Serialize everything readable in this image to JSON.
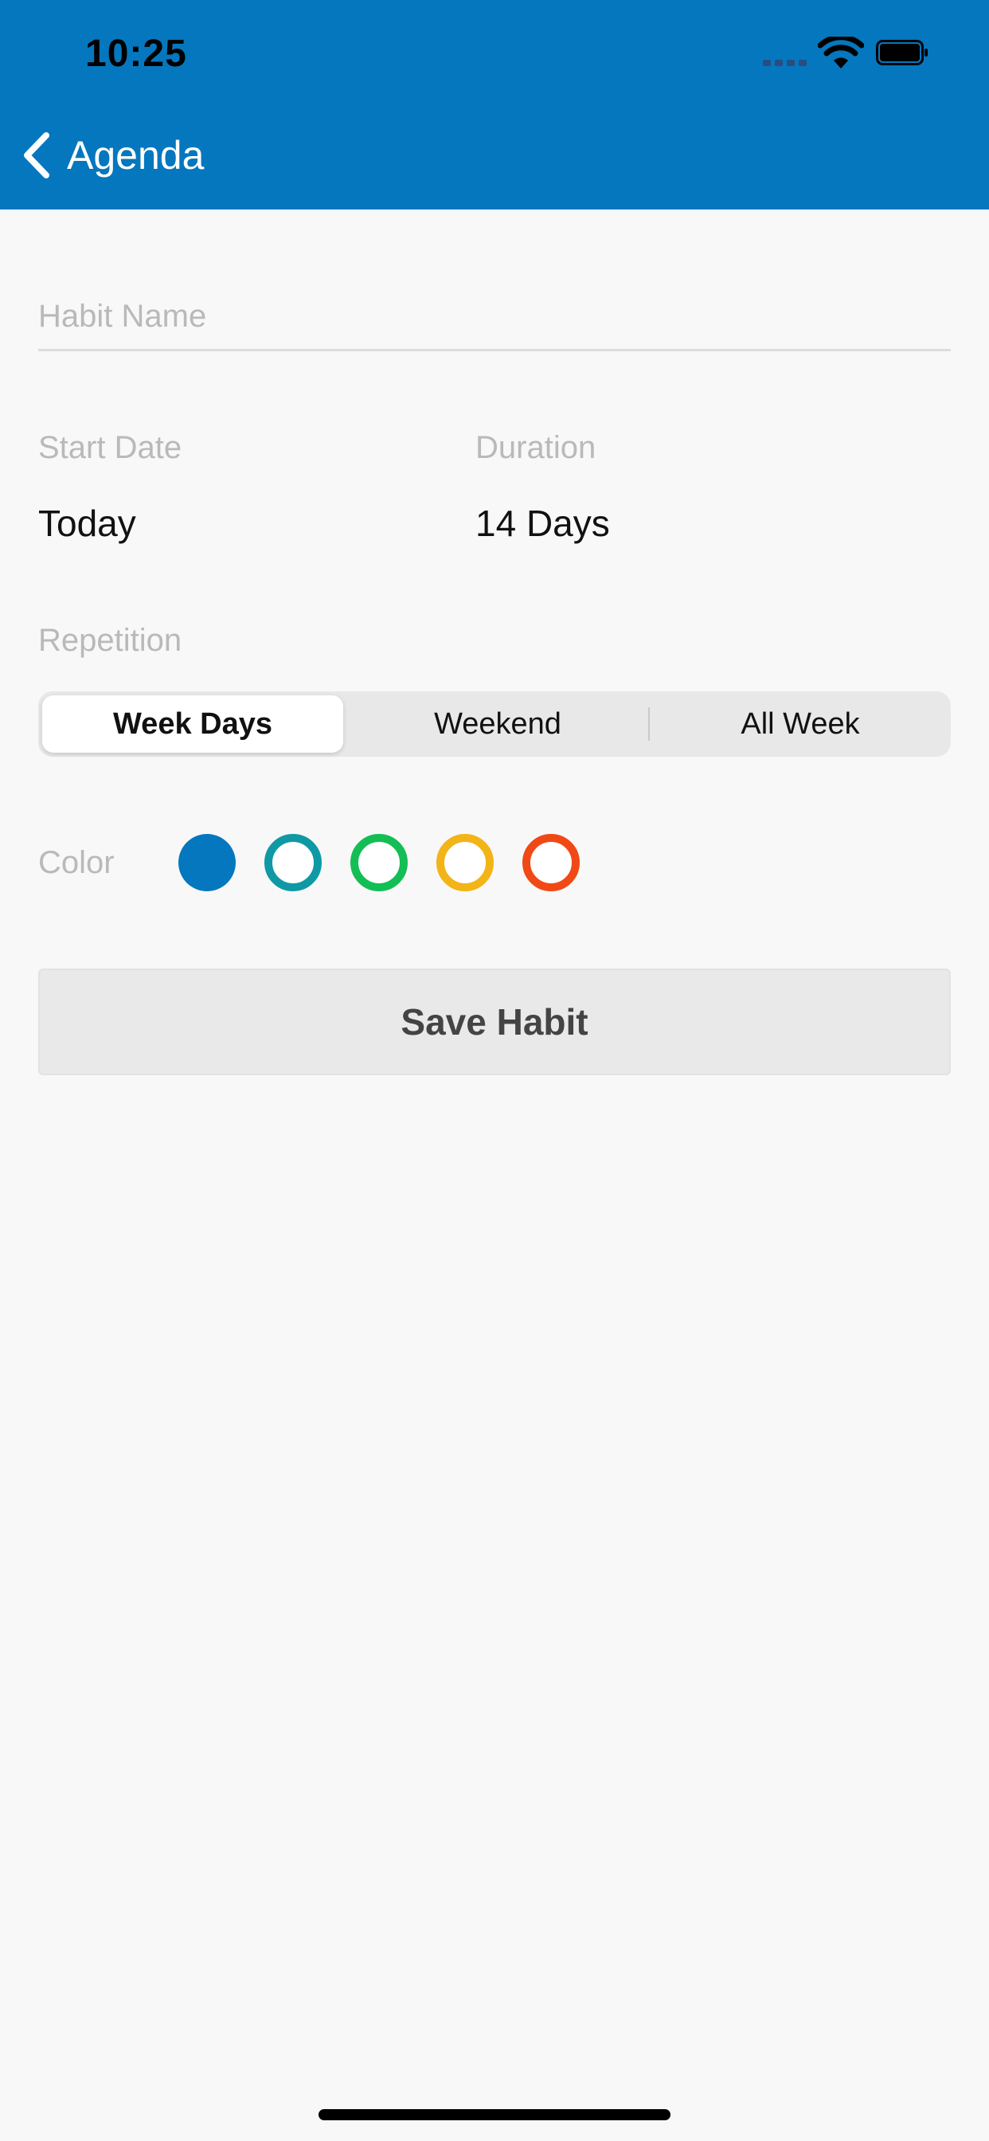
{
  "status_bar": {
    "time": "10:25",
    "icons": [
      "cellular-signal-icon",
      "wifi-icon",
      "battery-icon"
    ]
  },
  "nav": {
    "back_icon": "chevron-left-icon",
    "back_label": "Agenda"
  },
  "form": {
    "habit_name": {
      "placeholder": "Habit Name",
      "value": ""
    },
    "start_date": {
      "label": "Start Date",
      "value": "Today"
    },
    "duration": {
      "label": "Duration",
      "value": "14 Days"
    },
    "repetition": {
      "label": "Repetition",
      "options": [
        "Week Days",
        "Weekend",
        "All Week"
      ],
      "selected": "Week Days"
    },
    "color": {
      "label": "Color",
      "options": [
        {
          "name": "blue",
          "hex": "#0577be",
          "selected": true
        },
        {
          "name": "teal",
          "hex": "#0f99a5",
          "selected": false
        },
        {
          "name": "green",
          "hex": "#13be55",
          "selected": false
        },
        {
          "name": "yellow",
          "hex": "#f2b417",
          "selected": false
        },
        {
          "name": "orange",
          "hex": "#f04915",
          "selected": false
        }
      ]
    },
    "save_label": "Save Habit"
  },
  "colors": {
    "header_background": "#0577be",
    "page_background": "#f8f8f8"
  }
}
